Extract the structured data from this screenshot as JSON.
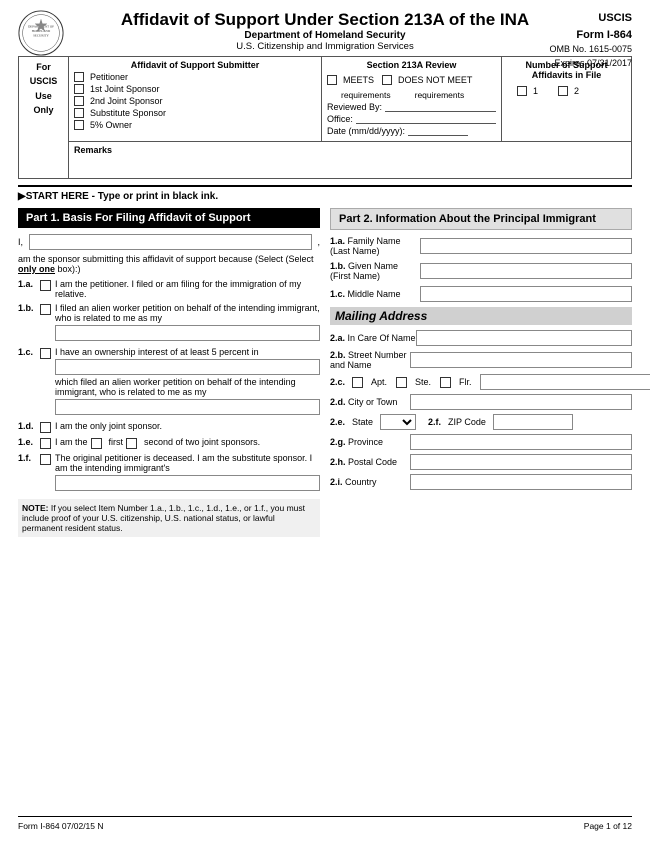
{
  "header": {
    "title": "Affidavit of Support Under Section 213A of the INA",
    "dept": "Department of Homeland Security",
    "agency": "U.S. Citizenship and Immigration Services",
    "uscis_label": "USCIS",
    "form_label": "Form I-864",
    "omb": "OMB No. 1615-0075",
    "expires": "Expires 07/31/2017"
  },
  "info_table": {
    "affidavit_submitter_header": "Affidavit of Support Submitter",
    "petitioner_label": "Petitioner",
    "joint_1_label": "1st Joint Sponsor",
    "joint_2_label": "2nd Joint Sponsor",
    "substitute_label": "Substitute Sponsor",
    "owner_label": "5% Owner",
    "section_213a_header": "Section 213A Review",
    "meets_label": "MEETS",
    "meets_sub": "requirements",
    "does_not_meet_label": "DOES NOT MEET",
    "does_not_meet_sub": "requirements",
    "reviewed_label": "Reviewed By:",
    "office_label": "Office:",
    "date_label": "Date (mm/dd/yyyy):",
    "num_affidavits_header": "Number of Support Affidavits in File",
    "num_1": "1",
    "num_2": "2",
    "remarks_label": "Remarks",
    "for_label": "For",
    "uscis_label": "USCIS",
    "use_label": "Use",
    "only_label": "Only"
  },
  "start_here": "▶START HERE - Type or print in black ink.",
  "part1": {
    "header": "Part 1.  Basis For Filing Affidavit of Support",
    "i_label": "I,",
    "i_suffix": ",",
    "sponsor_text": "am the sponsor submitting this affidavit of support because (Select",
    "only_text": "only one",
    "box_text": "box):",
    "item_1a_label": "1.a.",
    "item_1a_text": "I am the petitioner.  I filed or am filing for the immigration of my relative.",
    "item_1b_label": "1.b.",
    "item_1b_text": "I filed an alien worker petition on behalf of the intending immigrant, who is related to me as my",
    "item_1c_label": "1.c.",
    "item_1c_text": "I have an ownership interest of at least 5 percent in",
    "item_1c_text2": "which filed an alien worker petition on behalf of the intending immigrant, who is related to me as my",
    "item_1d_label": "1.d.",
    "item_1d_text": "I am the only joint sponsor.",
    "item_1e_label": "1.e.",
    "item_1e_prefix": "I am the",
    "item_1e_first": "first",
    "item_1e_second": "second of two joint sponsors.",
    "item_1f_label": "1.f.",
    "item_1f_text": "The original petitioner is deceased.  I am the substitute sponsor.  I am the intending immigrant's",
    "note_label": "NOTE:",
    "note_text": " If you select Item Number 1.a., 1.b., 1.c., 1.d., 1.e., or 1.f., you must include proof of your U.S. citizenship, U.S. national status, or lawful permanent resident status."
  },
  "part2": {
    "header": "Part 2.  Information About the Principal Immigrant",
    "family_name_label": "Family Name",
    "family_name_sub": "(Last Name)",
    "given_name_label": "Given Name",
    "given_name_sub": "(First Name)",
    "middle_name_label": "Middle Name",
    "item_1a_label": "1.a.",
    "item_1b_label": "1.b.",
    "item_1c_label": "1.c.",
    "mailing_header": "Mailing Address",
    "in_care_label": "In Care Of Name",
    "street_label": "Street Number",
    "street_sub": "and Name",
    "apt_label": "Apt.",
    "ste_label": "Ste.",
    "flr_label": "Flr.",
    "city_label": "City or Town",
    "state_label": "State",
    "zip_label": "ZIP Code",
    "province_label": "Province",
    "postal_label": "Postal Code",
    "country_label": "Country",
    "item_2a_label": "2.a.",
    "item_2b_label": "2.b.",
    "item_2c_label": "2.c.",
    "item_2d_label": "2.d.",
    "item_2e_label": "2.e.",
    "item_2f_label": "2.f.",
    "item_2g_label": "2.g.",
    "item_2h_label": "2.h.",
    "item_2i_label": "2.i."
  },
  "footer": {
    "left": "Form I-864  07/02/15  N",
    "right": "Page 1 of 12"
  }
}
